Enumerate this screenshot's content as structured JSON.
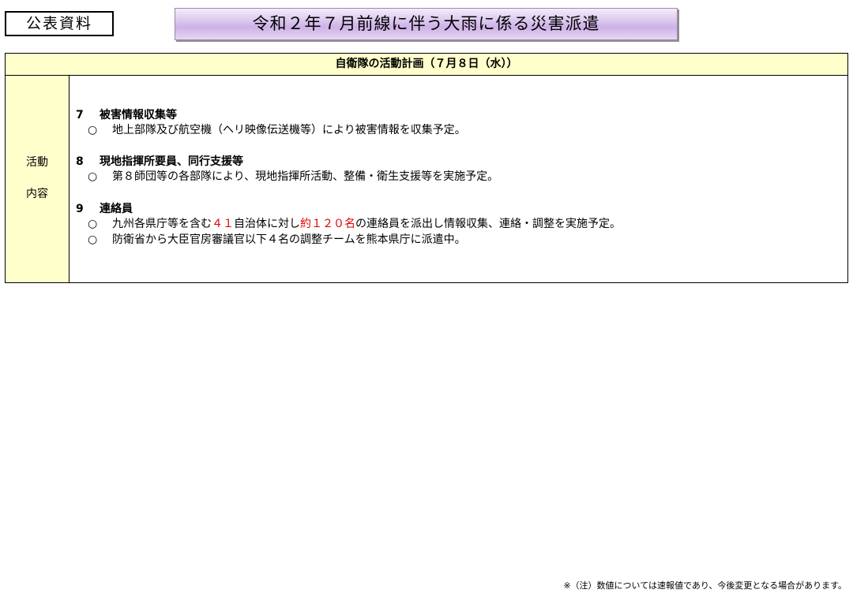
{
  "badge": "公表資料",
  "title": "令和２年７月前線に伴う大雨に係る災害派遣",
  "table": {
    "header": "自衛隊の活動計画（７月８日（水））",
    "row_label_line1": "活動",
    "row_label_line2": "内容",
    "sections": [
      {
        "number": "7",
        "heading": "被害情報収集等",
        "items": [
          {
            "bullet": "○",
            "text": "地上部隊及び航空機（ヘリ映像伝送機等）により被害情報を収集予定。"
          }
        ]
      },
      {
        "number": "8",
        "heading": "現地指揮所要員、同行支援等",
        "items": [
          {
            "bullet": "○",
            "text": "第８師団等の各部隊により、現地指揮所活動、整備・衛生支援等を実施予定。"
          }
        ]
      },
      {
        "number": "9",
        "heading": "連絡員",
        "items": [
          {
            "bullet": "○",
            "text_part1": "九州各県庁等を含む",
            "highlight1": "４１",
            "text_part2": "自治体に対し",
            "highlight2": "約１２０名",
            "text_part3": "の連絡員を派出し情報収集、連絡・調整を実施予定。"
          },
          {
            "bullet": "○",
            "text": "防衛省から大臣官房審議官以下４名の調整チームを熊本県庁に派遣中。"
          }
        ]
      }
    ]
  },
  "footnote": "※（注）数値については速報値であり、今後変更となる場合があります。",
  "colors": {
    "header_fill": "#ffffcc",
    "title_fill": "#d8c1ec",
    "highlight_text": "#e00000"
  }
}
